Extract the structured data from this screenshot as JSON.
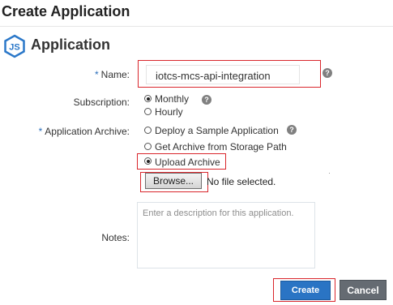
{
  "page": {
    "title": "Create Application"
  },
  "section": {
    "title": "Application",
    "logo_icon": "nodejs-logo"
  },
  "form": {
    "required_marker": "*",
    "name": {
      "label": "Name:",
      "value": "iotcs-mcs-api-integration"
    },
    "subscription": {
      "label": "Subscription:",
      "options": [
        "Monthly",
        "Hourly"
      ],
      "selected": "Monthly"
    },
    "archive": {
      "label": "Application Archive:",
      "options": [
        "Deploy a Sample Application",
        "Get Archive from Storage Path",
        "Upload Archive"
      ],
      "selected": "Upload Archive",
      "browse_label": "Browse...",
      "file_status": "No file selected."
    },
    "notes": {
      "label": "Notes:",
      "placeholder": "Enter a description for this application."
    },
    "help_glyph": "?"
  },
  "buttons": {
    "create": "Create",
    "cancel": "Cancel"
  },
  "colors": {
    "highlight": "#d9262c",
    "primary": "#2a74c4",
    "secondary": "#656b72",
    "logo": "#2b78c9",
    "required_marker": "#2a6ebb"
  }
}
